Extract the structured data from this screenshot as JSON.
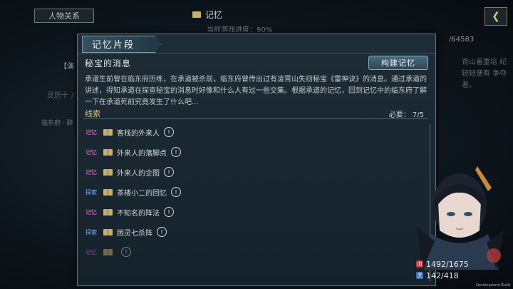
{
  "background": {
    "tab_label": "人物关系",
    "title": "记忆",
    "subtitle": "当前游戏进度：90%",
    "count": "/64583",
    "right_text": "背山着重培 纪轻轻便有 争夺者。",
    "left_tag": "【演",
    "left_text": "灵历十 八月",
    "left_small": "临东府 · 醉"
  },
  "dialog": {
    "title": "记忆片段",
    "quest_name": "秘宝的消息",
    "build_button": "构建记忆",
    "description": "承道生前曾在临东府历练，在承道被杀前，临东府曾传出过有凌霄山失窃秘宝《雷神诀》的消息。通过承道的讲述，得知承道在探查秘宝的消息时好像和什么人有过一些交集。根据承道的记忆，回到记忆中的临东府了解一下在承道死前究竟发生了什么吧...",
    "clues_label": "线索",
    "clues_required": "必要： 7/5",
    "clues": [
      {
        "tag": "记忆",
        "type": "mem",
        "text": "客栈的外来人",
        "alert": "!"
      },
      {
        "tag": "记忆",
        "type": "mem",
        "text": "外来人的落脚点",
        "alert": "!"
      },
      {
        "tag": "记忆",
        "type": "mem",
        "text": "外来人的企图",
        "alert": "!"
      },
      {
        "tag": "探索",
        "type": "expl",
        "text": "茶楼小二的回忆",
        "alert": "!"
      },
      {
        "tag": "记忆",
        "type": "mem",
        "text": "不知名的阵法",
        "alert": "!"
      },
      {
        "tag": "探索",
        "type": "expl",
        "text": "困灵七杀阵",
        "alert": "!"
      },
      {
        "tag": "记忆",
        "type": "mem",
        "text": "",
        "alert": "!"
      }
    ]
  },
  "character": {
    "hp": "1492/1675",
    "mp": "142/418",
    "hp_icon_label": "血",
    "mp_icon_label": "灵"
  },
  "footer": {
    "dev_build": "Development Build"
  }
}
